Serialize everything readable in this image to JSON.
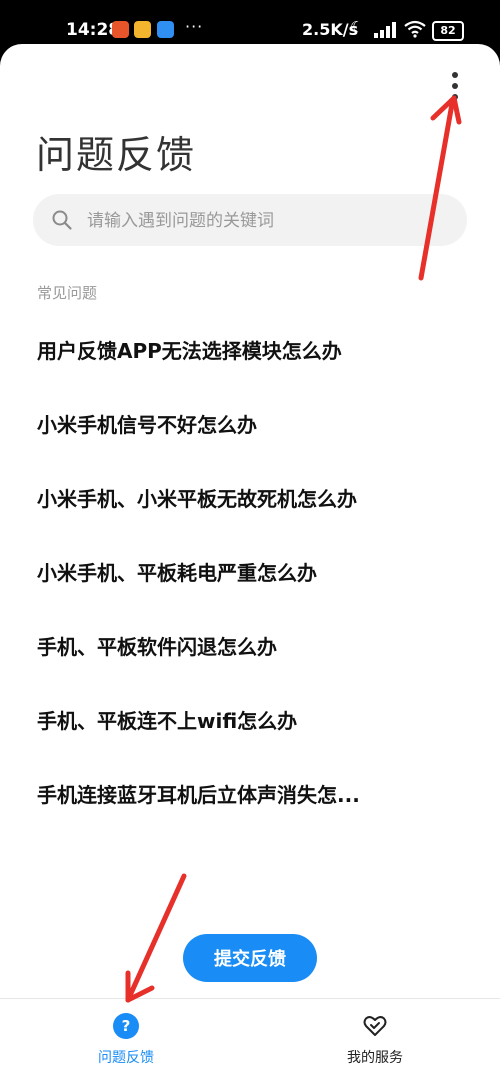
{
  "status_bar": {
    "time": "14:28",
    "dots": "···",
    "net_speed": "2.5K/s",
    "moon": "☾",
    "battery": "82"
  },
  "page": {
    "title": "问题反馈",
    "search_placeholder": "请输入遇到问题的关键词",
    "section_label": "常见问题"
  },
  "faq": [
    "用户反馈APP无法选择模块怎么办",
    "小米手机信号不好怎么办",
    "小米手机、小米平板无故死机怎么办",
    "小米手机、平板耗电严重怎么办",
    "手机、平板软件闪退怎么办",
    "手机、平板连不上wifi怎么办",
    "手机连接蓝牙耳机后立体声消失怎..."
  ],
  "submit_label": "提交反馈",
  "bottom_nav": [
    {
      "label": "问题反馈",
      "icon": "help-icon",
      "icon_glyph": "?"
    },
    {
      "label": "我的服务",
      "icon": "heart-icon"
    }
  ],
  "colors": {
    "accent": "#1a8cf5",
    "annotation": "#e8302a"
  }
}
